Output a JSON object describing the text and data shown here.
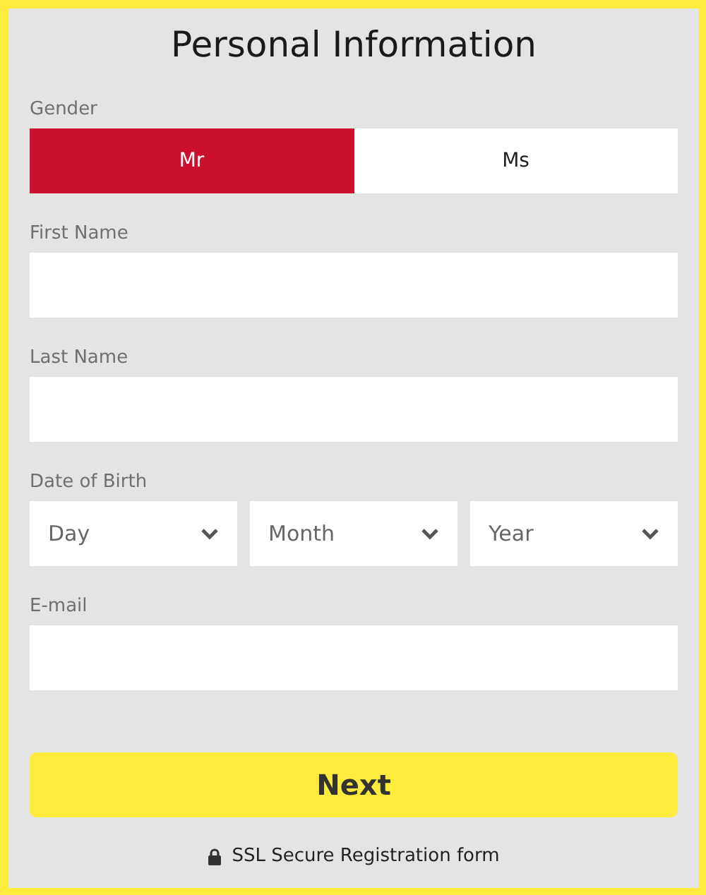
{
  "title": "Personal Information",
  "fields": [
    {
      "kind": "segmented",
      "label": "Gender",
      "options": [
        {
          "label": "Mr",
          "selected": true
        },
        {
          "label": "Ms",
          "selected": false
        }
      ]
    },
    {
      "kind": "text",
      "label": "First Name"
    },
    {
      "kind": "text",
      "label": "Last Name"
    },
    {
      "kind": "selects",
      "label": "Date of Birth",
      "options": [
        {
          "placeholder": "Day"
        },
        {
          "placeholder": "Month"
        },
        {
          "placeholder": "Year"
        }
      ]
    },
    {
      "kind": "text",
      "label": "E-mail"
    }
  ],
  "submit": "Next",
  "footer": "SSL Secure Registration form"
}
